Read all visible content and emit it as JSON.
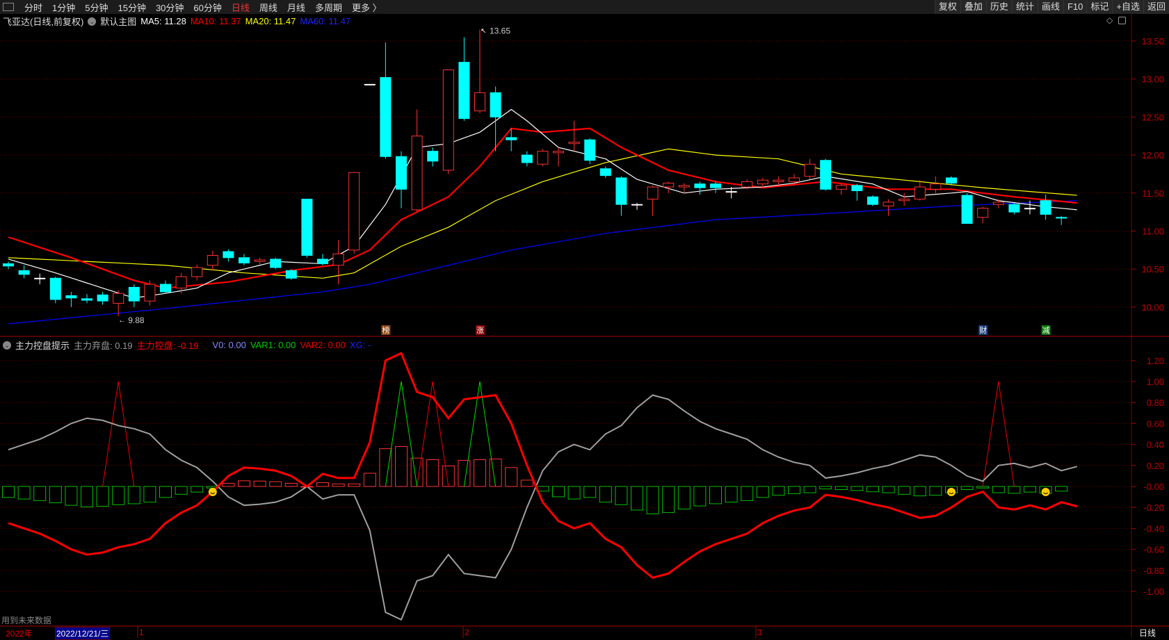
{
  "toolbar": {
    "periods": [
      "分时",
      "1分钟",
      "5分钟",
      "15分钟",
      "30分钟",
      "60分钟",
      "日线",
      "周线",
      "月线",
      "多周期",
      "更多 〉"
    ],
    "active": "日线",
    "right_buttons": [
      "复权",
      "叠加",
      "历史",
      "统计",
      "画线",
      "F10",
      "标记",
      "+自选",
      "返回"
    ]
  },
  "price_header": {
    "title": "飞亚达(日线,前复权)",
    "template": "默认主图",
    "ma5": "MA5: 11.28",
    "ma10": "MA10: 11.37",
    "ma20": "MA20: 11.47",
    "ma60": "MA60: 11.47"
  },
  "indicator_header": {
    "title": "主力控盘提示",
    "abandon": "主力弃盘: 0.19",
    "control": "主力控盘: -0.19",
    "v0": "V0: 0.00",
    "var1": "VAR1: 0.00",
    "var2": "VAR2: 0.00",
    "xg": "XG: -"
  },
  "colors": {
    "up": "#ff3232",
    "down": "#00ffff",
    "ma5": "#ffffff",
    "ma10": "#ff0000",
    "ma20": "#ffff00",
    "ma60": "#0000ff",
    "grid": "#800000",
    "gray": "#a0a0a0",
    "green": "#00c000"
  },
  "footer_note": "用到未来数据",
  "bottom_axis": {
    "year": "2022年",
    "cursor_date": "2022/12/21/三",
    "months": [
      "1",
      "2",
      "3"
    ],
    "period": "日线"
  },
  "markers": [
    {
      "label": "榜",
      "index": 24,
      "color": "#8b4513"
    },
    {
      "label": "涨",
      "index": 30,
      "color": "#8b0000"
    },
    {
      "label": "财",
      "index": 62,
      "color": "#1f3f7f"
    },
    {
      "label": "减",
      "index": 66,
      "color": "#0a7a0a"
    }
  ],
  "chart_data": [
    {
      "type": "candlestick",
      "title": "飞亚达(日线,前复权)",
      "ylim": [
        9.75,
        13.75
      ],
      "yticks": [
        "13.50",
        "13.00",
        "12.50",
        "12.00",
        "11.50",
        "11.00",
        "10.50",
        "10.00"
      ],
      "high_label": "13.65",
      "low_label": "9.88",
      "ohlc": [
        [
          10.57,
          10.54,
          10.6,
          10.5
        ],
        [
          10.48,
          10.43,
          10.55,
          10.38
        ],
        [
          10.38,
          10.38,
          10.44,
          10.3
        ],
        [
          10.38,
          10.1,
          10.4,
          10.05
        ],
        [
          10.15,
          10.12,
          10.2,
          10.0
        ],
        [
          10.11,
          10.09,
          10.17,
          10.05
        ],
        [
          10.16,
          10.08,
          10.2,
          10.03
        ],
        [
          10.05,
          10.18,
          10.22,
          9.88
        ],
        [
          10.26,
          10.08,
          10.3,
          10.0
        ],
        [
          10.08,
          10.3,
          10.35,
          10.02
        ],
        [
          10.3,
          10.2,
          10.35,
          10.18
        ],
        [
          10.25,
          10.4,
          10.45,
          10.18
        ],
        [
          10.4,
          10.52,
          10.56,
          10.35
        ],
        [
          10.55,
          10.68,
          10.74,
          10.48
        ],
        [
          10.73,
          10.65,
          10.76,
          10.6
        ],
        [
          10.65,
          10.58,
          10.7,
          10.55
        ],
        [
          10.6,
          10.62,
          10.65,
          10.56
        ],
        [
          10.63,
          10.52,
          10.65,
          10.5
        ],
        [
          10.48,
          10.38,
          10.5,
          10.36
        ],
        [
          11.42,
          10.68,
          11.42,
          10.65
        ],
        [
          10.63,
          10.57,
          10.7,
          10.55
        ],
        [
          10.55,
          10.7,
          10.88,
          10.3
        ],
        [
          10.75,
          11.77,
          11.77,
          10.7
        ],
        [
          12.93,
          12.93,
          12.93,
          12.93
        ],
        [
          13.02,
          11.98,
          13.48,
          11.95
        ],
        [
          11.98,
          11.55,
          12.05,
          11.3
        ],
        [
          11.28,
          12.25,
          12.6,
          11.25
        ],
        [
          12.05,
          11.92,
          12.1,
          11.85
        ],
        [
          11.8,
          13.12,
          13.12,
          11.75
        ],
        [
          13.22,
          12.48,
          13.55,
          12.45
        ],
        [
          12.58,
          12.82,
          13.65,
          12.55
        ],
        [
          12.82,
          12.5,
          12.9,
          12.05
        ],
        [
          12.23,
          12.2,
          12.35,
          12.05
        ],
        [
          12.0,
          11.9,
          12.05,
          11.85
        ],
        [
          11.88,
          12.05,
          12.08,
          11.85
        ],
        [
          12.03,
          12.05,
          12.1,
          11.85
        ],
        [
          12.15,
          12.17,
          12.45,
          12.05
        ],
        [
          12.2,
          11.93,
          12.22,
          11.88
        ],
        [
          11.82,
          11.73,
          11.85,
          11.7
        ],
        [
          11.7,
          11.35,
          11.72,
          11.2
        ],
        [
          11.35,
          11.35,
          11.37,
          11.28
        ],
        [
          11.42,
          11.58,
          11.6,
          11.2
        ],
        [
          11.58,
          11.63,
          11.65,
          11.5
        ],
        [
          11.58,
          11.6,
          11.63,
          11.5
        ],
        [
          11.62,
          11.57,
          11.65,
          11.48
        ],
        [
          11.62,
          11.57,
          11.65,
          11.5
        ],
        [
          11.52,
          11.52,
          11.58,
          11.43
        ],
        [
          11.58,
          11.65,
          11.68,
          11.55
        ],
        [
          11.62,
          11.67,
          11.7,
          11.57
        ],
        [
          11.65,
          11.67,
          11.72,
          11.58
        ],
        [
          11.65,
          11.7,
          11.75,
          11.6
        ],
        [
          11.72,
          11.88,
          11.95,
          11.68
        ],
        [
          11.93,
          11.55,
          11.95,
          11.53
        ],
        [
          11.55,
          11.6,
          11.62,
          11.48
        ],
        [
          11.6,
          11.53,
          11.62,
          11.4
        ],
        [
          11.45,
          11.35,
          11.47,
          11.33
        ],
        [
          11.33,
          11.38,
          11.42,
          11.2
        ],
        [
          11.4,
          11.42,
          11.5,
          11.33
        ],
        [
          11.42,
          11.58,
          11.67,
          11.4
        ],
        [
          11.55,
          11.62,
          11.72,
          11.5
        ],
        [
          11.7,
          11.63,
          11.72,
          11.6
        ],
        [
          11.47,
          11.1,
          11.5,
          11.1
        ],
        [
          11.18,
          11.3,
          11.32,
          11.1
        ],
        [
          11.35,
          11.38,
          11.42,
          11.3
        ],
        [
          11.35,
          11.25,
          11.37,
          11.22
        ],
        [
          11.3,
          11.3,
          11.4,
          11.22
        ],
        [
          11.4,
          11.22,
          11.48,
          11.15
        ],
        [
          11.18,
          11.17,
          11.2,
          11.08
        ]
      ],
      "ma_series": [
        {
          "name": "MA5",
          "color": "#ffffff",
          "points": [
            [
              0,
              10.63
            ],
            [
              3,
              10.45
            ],
            [
              6,
              10.25
            ],
            [
              8,
              10.12
            ],
            [
              10,
              10.18
            ],
            [
              12,
              10.25
            ],
            [
              14,
              10.45
            ],
            [
              17,
              10.6
            ],
            [
              20,
              10.57
            ],
            [
              22,
              10.8
            ],
            [
              24,
              11.35
            ],
            [
              26,
              12.1
            ],
            [
              28,
              12.15
            ],
            [
              30,
              12.3
            ],
            [
              32,
              12.6
            ],
            [
              33,
              12.45
            ],
            [
              35,
              12.1
            ],
            [
              38,
              11.95
            ],
            [
              40,
              11.68
            ],
            [
              43,
              11.5
            ],
            [
              45,
              11.55
            ],
            [
              48,
              11.58
            ],
            [
              50,
              11.63
            ],
            [
              52,
              11.72
            ],
            [
              55,
              11.62
            ],
            [
              57,
              11.45
            ],
            [
              60,
              11.5
            ],
            [
              61,
              11.52
            ],
            [
              63,
              11.4
            ],
            [
              66,
              11.32
            ],
            [
              68,
              11.28
            ]
          ]
        },
        {
          "name": "MA10",
          "color": "#ff0000",
          "points": [
            [
              0,
              10.92
            ],
            [
              4,
              10.65
            ],
            [
              8,
              10.35
            ],
            [
              10,
              10.25
            ],
            [
              14,
              10.33
            ],
            [
              18,
              10.48
            ],
            [
              21,
              10.56
            ],
            [
              23,
              10.75
            ],
            [
              25,
              11.15
            ],
            [
              28,
              11.45
            ],
            [
              30,
              11.85
            ],
            [
              32,
              12.35
            ],
            [
              34,
              12.3
            ],
            [
              37,
              12.35
            ],
            [
              39,
              12.1
            ],
            [
              42,
              11.8
            ],
            [
              45,
              11.65
            ],
            [
              48,
              11.57
            ],
            [
              52,
              11.65
            ],
            [
              56,
              11.55
            ],
            [
              60,
              11.55
            ],
            [
              64,
              11.45
            ],
            [
              68,
              11.37
            ]
          ]
        },
        {
          "name": "MA20",
          "color": "#ffff00",
          "points": [
            [
              0,
              10.65
            ],
            [
              10,
              10.55
            ],
            [
              15,
              10.45
            ],
            [
              20,
              10.38
            ],
            [
              22,
              10.45
            ],
            [
              25,
              10.8
            ],
            [
              28,
              11.05
            ],
            [
              31,
              11.4
            ],
            [
              34,
              11.65
            ],
            [
              38,
              11.9
            ],
            [
              42,
              12.08
            ],
            [
              45,
              12.0
            ],
            [
              49,
              11.95
            ],
            [
              53,
              11.75
            ],
            [
              58,
              11.65
            ],
            [
              62,
              11.57
            ],
            [
              68,
              11.47
            ]
          ]
        },
        {
          "name": "MA60",
          "color": "#0000ff",
          "points": [
            [
              0,
              9.78
            ],
            [
              10,
              9.98
            ],
            [
              20,
              10.2
            ],
            [
              23,
              10.3
            ],
            [
              27,
              10.5
            ],
            [
              32,
              10.75
            ],
            [
              38,
              10.97
            ],
            [
              45,
              11.15
            ],
            [
              52,
              11.23
            ],
            [
              60,
              11.33
            ],
            [
              68,
              11.4
            ]
          ]
        }
      ]
    },
    {
      "type": "line",
      "title": "主力控盘提示",
      "ylim": [
        -1.2,
        1.4
      ],
      "yticks": [
        "1.20",
        "1.00",
        "0.80",
        "0.60",
        "0.40",
        "0.20",
        "-0.00",
        "-0.20",
        "-0.40",
        "-0.60",
        "-0.80",
        "-1.00"
      ],
      "control": [
        -0.35,
        -0.4,
        -0.45,
        -0.52,
        -0.6,
        -0.65,
        -0.63,
        -0.58,
        -0.55,
        -0.5,
        -0.35,
        -0.25,
        -0.18,
        -0.05,
        0.1,
        0.18,
        0.17,
        0.15,
        0.1,
        0.0,
        0.12,
        0.08,
        0.08,
        0.42,
        1.2,
        1.27,
        0.9,
        0.85,
        0.65,
        0.83,
        0.85,
        0.87,
        0.6,
        0.2,
        -0.15,
        -0.33,
        -0.4,
        -0.35,
        -0.5,
        -0.58,
        -0.75,
        -0.87,
        -0.83,
        -0.72,
        -0.62,
        -0.55,
        -0.5,
        -0.45,
        -0.35,
        -0.28,
        -0.23,
        -0.2,
        -0.08,
        -0.1,
        -0.13,
        -0.17,
        -0.2,
        -0.25,
        -0.3,
        -0.28,
        -0.2,
        -0.1,
        -0.05,
        -0.2,
        -0.22,
        -0.18,
        -0.22,
        -0.15,
        -0.19
      ],
      "bar_scale": 0.3,
      "var2_spikes": [
        7,
        27,
        63
      ],
      "var1_spikes": [
        25,
        30
      ],
      "smiley_indices": [
        13,
        60,
        66
      ]
    }
  ]
}
